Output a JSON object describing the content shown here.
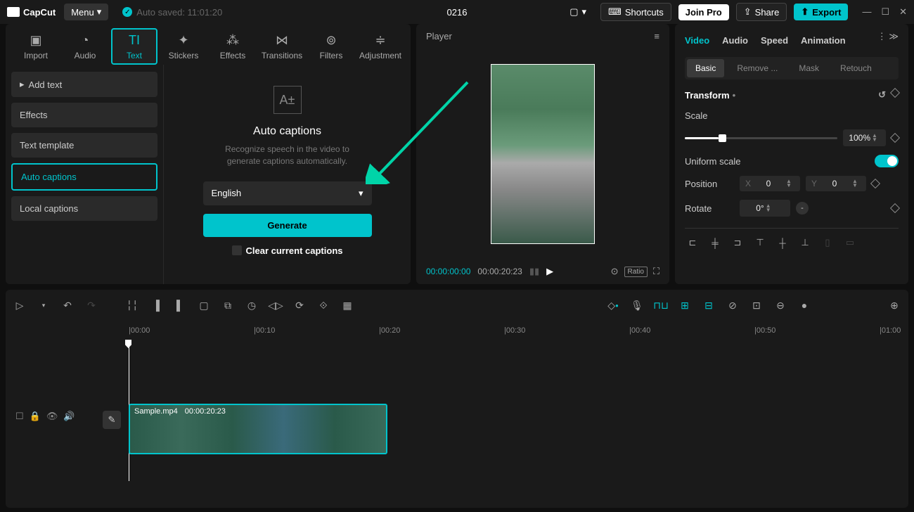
{
  "app": {
    "name": "CapCut"
  },
  "titlebar": {
    "menu": "Menu",
    "autosaved": "Auto saved: 11:01:20",
    "project": "0216",
    "shortcuts": "Shortcuts",
    "joinpro": "Join Pro",
    "share": "Share",
    "export": "Export"
  },
  "categories": {
    "import": "Import",
    "audio": "Audio",
    "text": "Text",
    "stickers": "Stickers",
    "effects": "Effects",
    "transitions": "Transitions",
    "filters": "Filters",
    "adjustment": "Adjustment"
  },
  "sidebar": {
    "addtext": "Add text",
    "effects": "Effects",
    "template": "Text template",
    "auto": "Auto captions",
    "local": "Local captions"
  },
  "captions": {
    "title": "Auto captions",
    "desc1": "Recognize speech in the video to",
    "desc2": "generate captions automatically.",
    "language": "English",
    "generate": "Generate",
    "clear": "Clear current captions"
  },
  "player": {
    "title": "Player",
    "current": "00:00:00:00",
    "duration": "00:00:20:23",
    "ratio": "Ratio"
  },
  "right": {
    "tabs": {
      "video": "Video",
      "audio": "Audio",
      "speed": "Speed",
      "animation": "Animation"
    },
    "subtabs": {
      "basic": "Basic",
      "remove": "Remove ...",
      "mask": "Mask",
      "retouch": "Retouch"
    },
    "transform": "Transform",
    "scale": "Scale",
    "scale_value": "100%",
    "uniform": "Uniform scale",
    "position": "Position",
    "pos_x_label": "X",
    "pos_x": "0",
    "pos_y_label": "Y",
    "pos_y": "0",
    "rotate": "Rotate",
    "rotate_value": "0°"
  },
  "ruler": {
    "t0": "|00:00",
    "t1": "|00:10",
    "t2": "|00:20",
    "t3": "|00:30",
    "t4": "|00:40",
    "t5": "|00:50",
    "t6": "|01:00"
  },
  "clip": {
    "name": "Sample.mp4",
    "dur": "00:00:20:23"
  }
}
